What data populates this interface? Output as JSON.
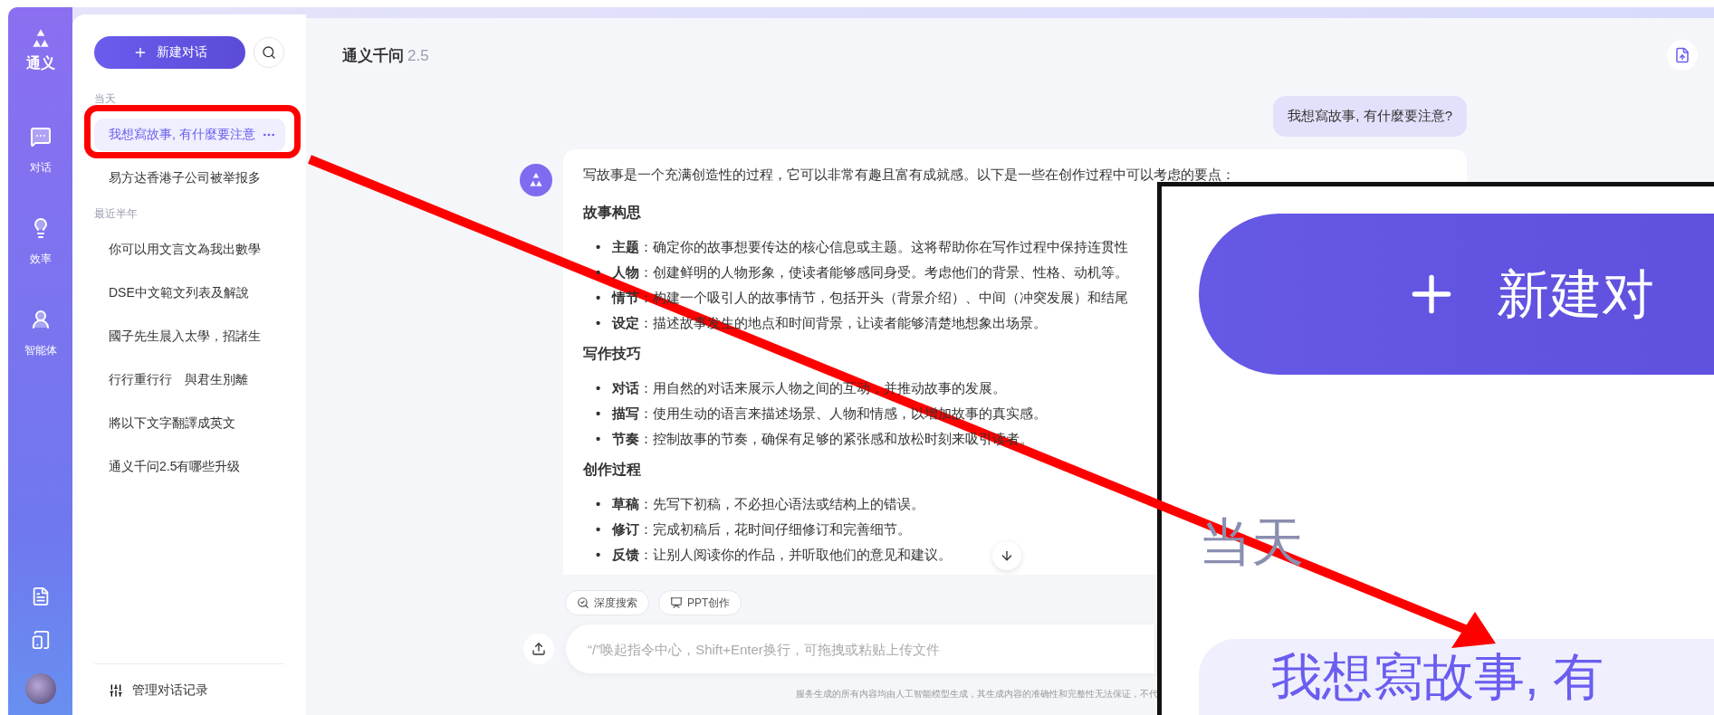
{
  "rail": {
    "logo": "通义",
    "items": [
      {
        "label": "对话",
        "kind": "chat"
      },
      {
        "label": "效率",
        "kind": "bulb"
      },
      {
        "label": "智能体",
        "kind": "agent"
      }
    ]
  },
  "sidebar": {
    "new_chat": "新建对话",
    "groups": [
      {
        "label": "当天",
        "items": [
          {
            "title": "我想寫故事, 有什麼要注意",
            "selected": true
          },
          {
            "title": "易方达香港子公司被举报多",
            "selected": false
          }
        ]
      },
      {
        "label": "最近半年",
        "items": [
          {
            "title": "你可以用文言文為我出數學",
            "selected": false
          },
          {
            "title": "DSE中文範文列表及解說",
            "selected": false
          },
          {
            "title": "國子先生晨入太學，招諸生",
            "selected": false
          },
          {
            "title": "行行重行行　與君生別離",
            "selected": false
          },
          {
            "title": "將以下文字翻譯成英文",
            "selected": false
          },
          {
            "title": "通义千问2.5有哪些升级",
            "selected": false
          }
        ]
      }
    ],
    "manage": "管理对话记录"
  },
  "header": {
    "title": "通义千问",
    "version": "2.5"
  },
  "conversation": {
    "user_message": "我想寫故事, 有什麼要注意?",
    "answer": {
      "intro": "写故事是一个充满创造性的过程，它可以非常有趣且富有成就感。以下是一些在创作过程中可以考虑的要点：",
      "sections": [
        {
          "heading": "故事构思",
          "points": [
            {
              "bullet": "•",
              "text": "**主题**：确定你的故事想要传达的核心信息或主题。这将帮助你在写作过程中保持连贯性"
            },
            {
              "bullet": "•",
              "text": "**人物**：创建鲜明的人物形象，使读者能够感同身受。考虑他们的背景、性格、动机等。"
            },
            {
              "bullet": "•",
              "text": "**情节**：构建一个吸引人的故事情节，包括开头（背景介绍）、中间（冲突发展）和结尾"
            },
            {
              "bullet": "•",
              "text": "**设定**：描述故事发生的地点和时间背景，让读者能够清楚地想象出场景。"
            }
          ]
        },
        {
          "heading": "写作技巧",
          "points": [
            {
              "bullet": "•",
              "text": "**对话**：用自然的对话来展示人物之间的互动，并推动故事的发展。"
            },
            {
              "bullet": "•",
              "text": "**描写**：使用生动的语言来描述场景、人物和情感，以增加故事的真实感。"
            },
            {
              "bullet": "•",
              "text": "**节奏**：控制故事的节奏，确保有足够的紧张感和放松时刻来吸引读者。"
            }
          ]
        },
        {
          "heading": "创作过程",
          "points": [
            {
              "bullet": "•",
              "text": "**草稿**：先写下初稿，不必担心语法或结构上的错误。"
            },
            {
              "bullet": "•",
              "text": "**修订**：完成初稿后，花时间仔细修订和完善细节。"
            },
            {
              "bullet": "•",
              "text": "**反馈**：让别人阅读你的作品，并听取他们的意见和建议。"
            }
          ]
        }
      ]
    }
  },
  "composer": {
    "tools": [
      {
        "label": "深度搜索",
        "kind": "search"
      },
      {
        "label": "PPT创作",
        "kind": "slides"
      }
    ],
    "placeholder": "“/”唤起指令中心，Shift+Enter换行，可拖拽或粘贴上传文件",
    "disclaimer": "服务生成的所有内容均由人工智能模型生成，其生成内容的准确性和完整性无法保证，不代"
  },
  "annotation": {
    "inset": {
      "button_label": "新建对",
      "section_label": "当天",
      "item_label": "我想寫故事, 有"
    }
  }
}
